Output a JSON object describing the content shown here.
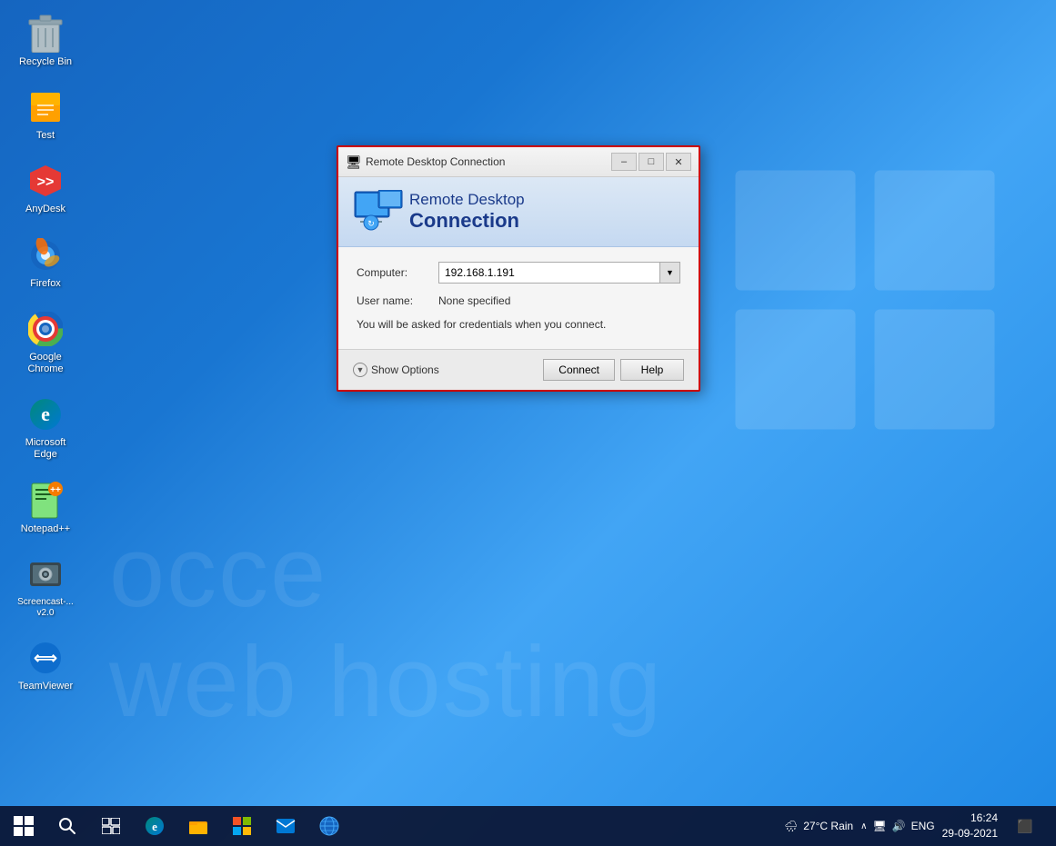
{
  "desktop": {
    "icons": [
      {
        "id": "recycle-bin",
        "label": "Recycle Bin",
        "icon": "🗑️"
      },
      {
        "id": "test",
        "label": "Test",
        "icon": "📁"
      },
      {
        "id": "anydesk",
        "label": "AnyDesk",
        "icon": "◆"
      },
      {
        "id": "firefox",
        "label": "Firefox",
        "icon": "🦊"
      },
      {
        "id": "google-chrome",
        "label": "Google Chrome",
        "icon": "⬤"
      },
      {
        "id": "microsoft-edge",
        "label": "Microsoft Edge",
        "icon": "e"
      },
      {
        "id": "notepadpp",
        "label": "Notepad++",
        "icon": "📝"
      },
      {
        "id": "screencast",
        "label": "Screencast-...\nv2.0",
        "icon": "⏺"
      },
      {
        "id": "teamviewer",
        "label": "TeamViewer",
        "icon": "⟺"
      }
    ]
  },
  "dialog": {
    "title": "Remote Desktop Connection",
    "title_icon": "🖥",
    "header_line1": "Remote Desktop",
    "header_line2": "Connection",
    "computer_label": "Computer:",
    "computer_value": "192.168.1.191",
    "username_label": "User name:",
    "username_value": "None specified",
    "info_text": "You will be asked for credentials when you connect.",
    "show_options_label": "Show Options",
    "connect_btn": "Connect",
    "help_btn": "Help",
    "controls": {
      "minimize": "–",
      "restore": "□",
      "close": "✕"
    }
  },
  "taskbar": {
    "start_label": "Start",
    "weather": "27°C Rain",
    "language": "ENG",
    "time": "16:24",
    "date": "29-09-2021",
    "notification_icon": "🔔"
  },
  "watermark": {
    "line1": "occe",
    "line2": "web hosting"
  }
}
